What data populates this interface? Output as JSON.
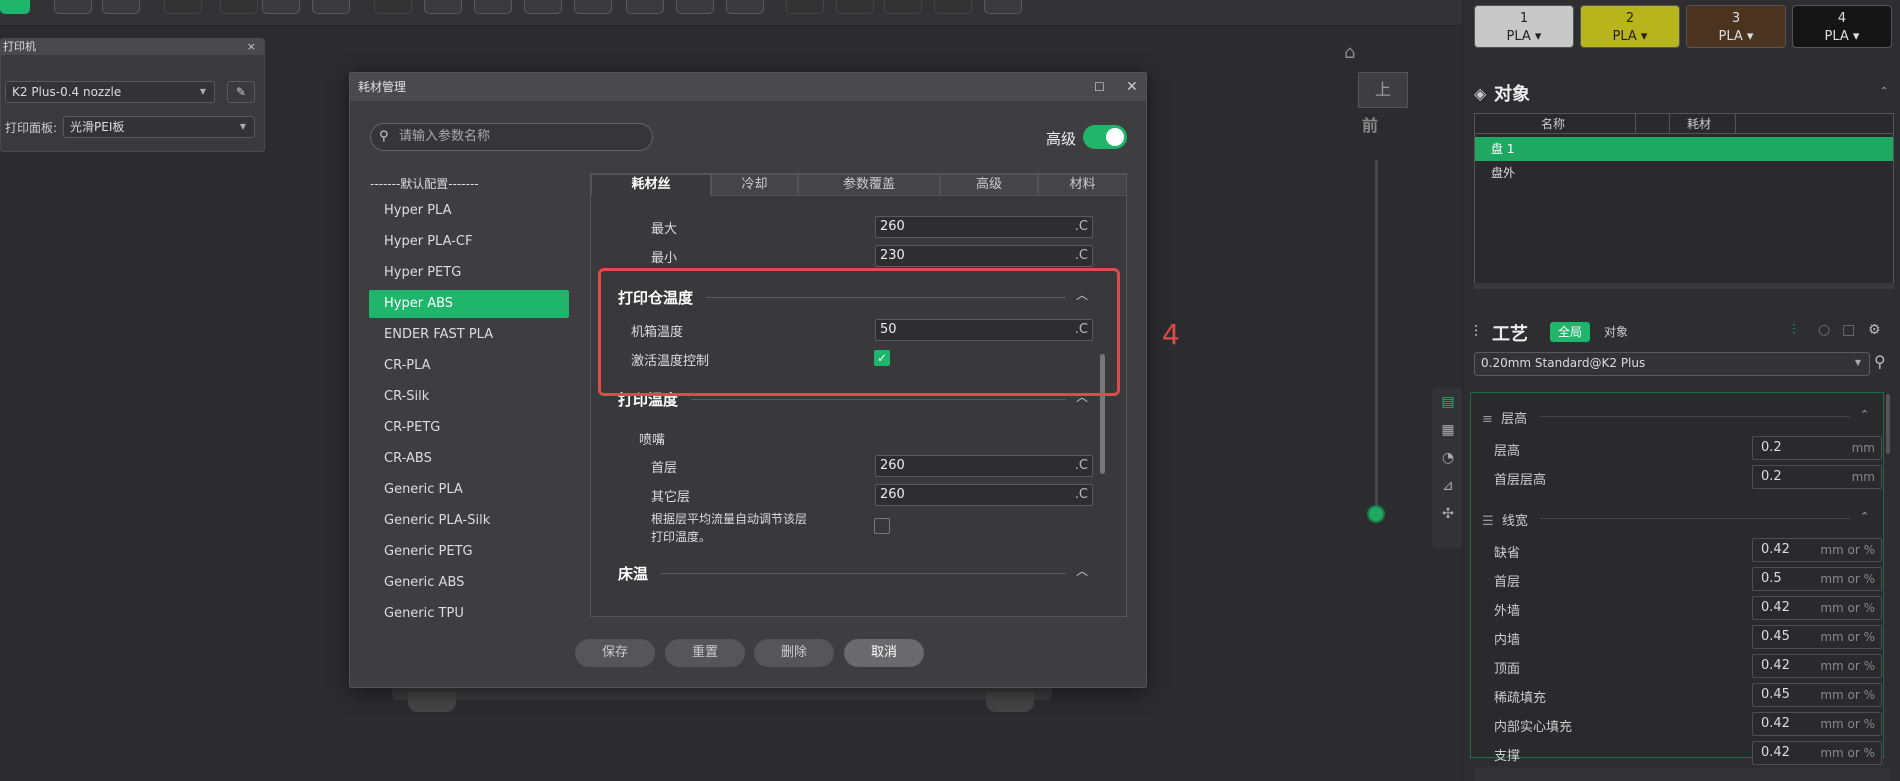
{
  "printer_panel": {
    "title": "打印机",
    "close": "×",
    "printer_model": "K2 Plus-0.4 nozzle",
    "plate_label": "打印面板:",
    "plate_value": "光滑PEI板"
  },
  "view": {
    "cube_top": "上",
    "cube_front": "前"
  },
  "filaments": [
    {
      "num": "1",
      "type": "PLA ▾",
      "color": "#c8c8c8",
      "text": "#222"
    },
    {
      "num": "2",
      "type": "PLA ▾",
      "color": "#b8b41c",
      "text": "#222"
    },
    {
      "num": "3",
      "type": "PLA ▾",
      "color": "#4a3420",
      "text": "#ddd"
    },
    {
      "num": "4",
      "type": "PLA ▾",
      "color": "#151515",
      "text": "#ddd"
    }
  ],
  "objects": {
    "title": "对象",
    "col_name": "名称",
    "col_filament": "耗材",
    "rows": [
      "盘 1",
      "盘外"
    ]
  },
  "process": {
    "title": "工艺",
    "global_tab": "全局",
    "object_tab": "对象",
    "preset": "0.20mm Standard@K2 Plus",
    "group_layer": "层高",
    "layer_rows": [
      {
        "label": "层高",
        "value": "0.2",
        "unit": "mm"
      },
      {
        "label": "首层层高",
        "value": "0.2",
        "unit": "mm"
      }
    ],
    "group_width": "线宽",
    "width_rows": [
      {
        "label": "缺省",
        "value": "0.42",
        "unit": "mm or %"
      },
      {
        "label": "首层",
        "value": "0.5",
        "unit": "mm or %"
      },
      {
        "label": "外墙",
        "value": "0.42",
        "unit": "mm or %"
      },
      {
        "label": "内墙",
        "value": "0.45",
        "unit": "mm or %"
      },
      {
        "label": "顶面",
        "value": "0.42",
        "unit": "mm or %"
      },
      {
        "label": "稀疏填充",
        "value": "0.45",
        "unit": "mm or %"
      },
      {
        "label": "内部实心填充",
        "value": "0.42",
        "unit": "mm or %"
      },
      {
        "label": "支撑",
        "value": "0.42",
        "unit": "mm or %"
      }
    ]
  },
  "modal": {
    "title": "耗材管理",
    "search_placeholder": "请输入参数名称",
    "advanced_label": "高级",
    "list_header": "-------默认配置-------",
    "list": [
      "Hyper PLA",
      "Hyper PLA-CF",
      "Hyper PETG",
      "Hyper ABS",
      "ENDER FAST PLA",
      "CR-PLA",
      "CR-Silk",
      "CR-PETG",
      "CR-ABS",
      "Generic PLA",
      "Generic PLA-Silk",
      "Generic PETG",
      "Generic ABS",
      "Generic TPU"
    ],
    "selected_index": 3,
    "tabs": [
      "耗材丝",
      "冷却",
      "参数覆盖",
      "高级",
      "材料"
    ],
    "max_label": "最大",
    "max_value": "260",
    "min_label": "最小",
    "min_value": "230",
    "unit": ".C",
    "chamber_title": "打印仓温度",
    "chamber_temp_label": "机箱温度",
    "chamber_temp_value": "50",
    "chamber_ctrl_label": "激活温度控制",
    "print_temp_title": "打印温度",
    "nozzle_label": "喷嘴",
    "first_layer_label": "首层",
    "first_layer_value": "260",
    "other_layer_label": "其它层",
    "other_layer_value": "260",
    "auto_adjust_label_1": "根据层平均流量自动调节该层",
    "auto_adjust_label_2": "打印温度。",
    "bed_title": "床温",
    "btn_save": "保存",
    "btn_reset": "重置",
    "btn_delete": "删除",
    "btn_cancel": "取消"
  },
  "annotation": {
    "label": "4",
    "color": "#e14a4a"
  }
}
